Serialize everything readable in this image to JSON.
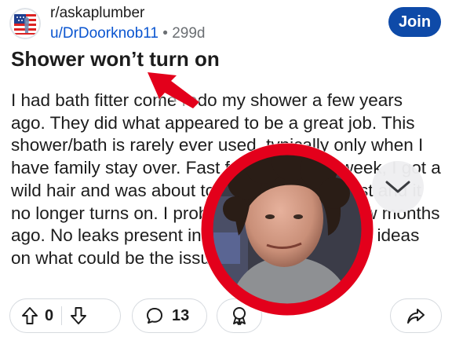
{
  "header": {
    "subreddit": "r/askaplumber",
    "username": "u/DrDoorknob11",
    "separator": "•",
    "age": "299d",
    "join_label": "Join"
  },
  "post": {
    "title": "Shower won’t turn on",
    "body": "I had bath fitter come redo my shower a few years ago. They did what appeared to be a great job. This shower/bath is rarely ever used, typically only when I have family stay over. Fast forward to this week, I got a wild hair and was about to clean up some dust and it no longer turns on. I probably last used it a few months ago. No leaks present in the 3 years bath. Any ideas on what could be the issues?"
  },
  "footer": {
    "vote_count": "0",
    "comment_count": "13"
  },
  "colors": {
    "join_bg": "#0e4aa8",
    "user_link": "#0a55d0",
    "arrow_red": "#e3001b",
    "circle_ring": "#e3001b"
  },
  "icons": {
    "avatar": "subreddit-flag-avatar",
    "upvote": "arrow-up-icon",
    "downvote": "arrow-down-icon",
    "comment": "speech-bubble-icon",
    "award": "award-ribbon-icon",
    "share": "share-arrow-icon",
    "scroll": "chevron-down-icon",
    "annotation": "red-arrow-icon"
  }
}
